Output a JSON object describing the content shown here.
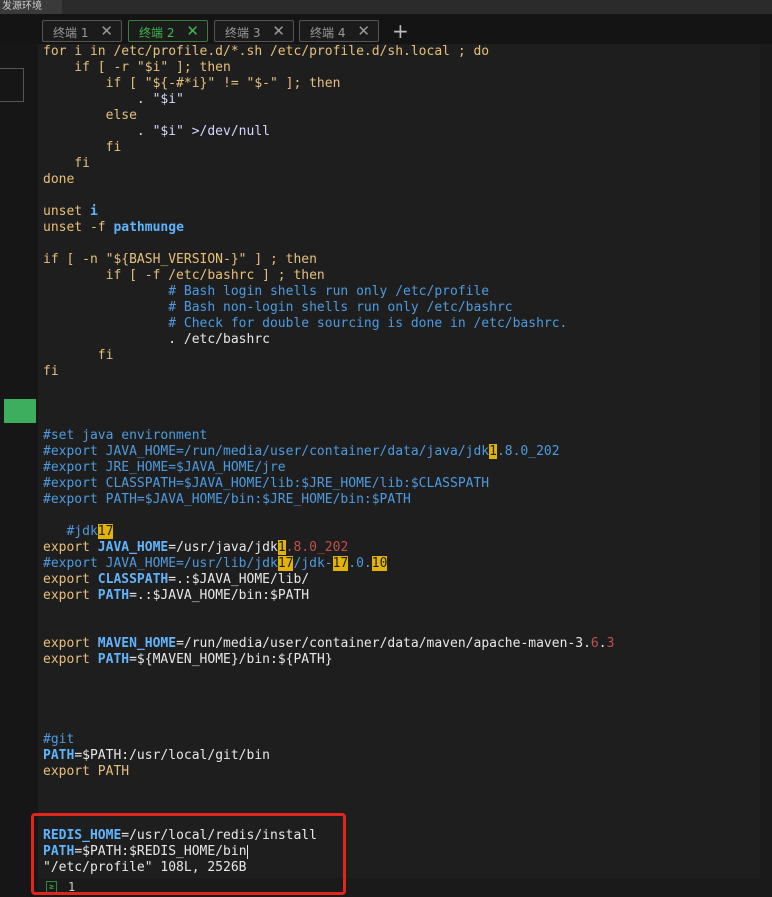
{
  "window": {
    "title": "发源环境"
  },
  "tabs": [
    {
      "label": "终端 1",
      "close": "✕",
      "active": false
    },
    {
      "label": "终端 2",
      "close": "✕",
      "active": true
    },
    {
      "label": "终端 3",
      "close": "✕",
      "active": false
    },
    {
      "label": "终端 4",
      "close": "✕",
      "active": false
    }
  ],
  "new_tab_label": "+",
  "editor": {
    "lines": {
      "l01a": "for i in /etc/profile.d/*.sh /etc/profile.d/sh.local ; do",
      "l02a": "    if [ -r \"$i\" ]; then",
      "l03a": "        if [ \"${-#*i}\" != \"$-\" ]; then",
      "l04a": "            . \"$i\"",
      "l05a": "        else",
      "l06a": "            . \"$i\" >/dev/null",
      "l07a": "        fi",
      "l08a": "    fi",
      "l09a": "done",
      "l11a": "unset ",
      "l11b": "i",
      "l12a": "unset -f ",
      "l12b": "pathmunge",
      "l14a": "if [ -n \"${BASH_VERSION-}\" ] ; then",
      "l15a": "        if [ -f /etc/bashrc ] ; then",
      "l16a": "                # Bash login shells run only /etc/profile",
      "l17a": "                # Bash non-login shells run only /etc/bashrc",
      "l18a": "                # Check for double sourcing is done in /etc/bashrc.",
      "l19a": "                . /etc/bashrc",
      "l20a": "       fi",
      "l21a": "fi",
      "l25a": "#set java environment",
      "l26a": "#export JAVA_HOME=/run/media/user/container/data/java/jdk",
      "l26h": "1",
      "l26b": ".8.0_202",
      "l27a": "#export JRE_HOME=$JAVA_HOME/jre",
      "l28a": "#export CLASSPATH=$JAVA_HOME/lib:$JRE_HOME/lib:$CLASSPATH",
      "l29a": "#export PATH=$JAVA_HOME/bin:$JRE_HOME/bin:$PATH",
      "l31a": "   #jdk",
      "l31h": "17",
      "l32a": "export ",
      "l32b": "JAVA_HOME",
      "l32c": "=/usr/java/jdk",
      "l32h": "1",
      "l32d": ".8.0_202",
      "l33a": "#export JAVA_HOME=/usr/lib/jdk",
      "l33h1": "17",
      "l33b": "/jdk-",
      "l33h2": "17",
      "l33c": ".0.",
      "l33h3": "10",
      "l34a": "export ",
      "l34b": "CLASSPATH",
      "l34c": "=.:$JAVA_HOME/lib/",
      "l35a": "export ",
      "l35b": "PATH",
      "l35c": "=.:$JAVA_HOME/bin:$PATH",
      "l38a": "export ",
      "l38b": "MAVEN_HOME",
      "l38c": "=/run/media/user/container/data/maven/apache-maven-3.",
      "l38d": "6",
      "l38e": ".",
      "l38f": "3",
      "l39a": "export ",
      "l39b": "PATH",
      "l39c": "=${MAVEN_HOME}/bin:${PATH}",
      "l44a": "#git",
      "l45a": "PATH",
      "l45b": "=$PATH:/usr/local/git/bin",
      "l46a": "export PATH",
      "l50a": "REDIS_HOME",
      "l50b": "=/usr/local/redis/install",
      "l51a": "PATH",
      "l51b": "=$PATH:$REDIS_HOME/bi",
      "l51c": "n",
      "l52a": "\"/etc/profile\" 108L, 2526B"
    }
  },
  "status": {
    "prompt_icon": "≥",
    "line_number": "1"
  },
  "colors": {
    "accent_green": "#3fb950",
    "highlight_box": "#e0261f",
    "search_highlight": "#e2b400"
  }
}
